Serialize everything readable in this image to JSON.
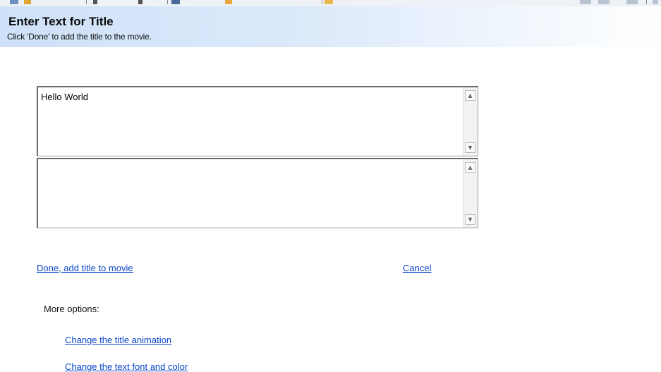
{
  "header": {
    "title": "Enter Text for Title",
    "subtitle": "Click 'Done' to add the title to the movie."
  },
  "title_editor": {
    "main_text": "Hello World",
    "secondary_text": "",
    "scroll_up_icon": "up-arrow-icon",
    "scroll_down_icon": "down-arrow-icon"
  },
  "actions": {
    "done_label": "Done, add title to movie",
    "cancel_label": "Cancel"
  },
  "more_options": {
    "label": "More options:",
    "items": [
      {
        "label": "Change the title animation"
      },
      {
        "label": "Change the text font and color"
      }
    ]
  },
  "colors": {
    "link": "#0b45c8",
    "header_gradient_start": "#cfe1f8",
    "header_gradient_end": "#ffffff"
  }
}
